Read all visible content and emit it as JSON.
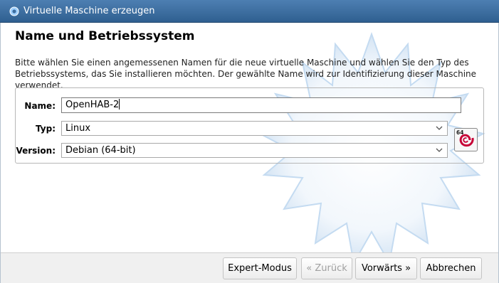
{
  "window": {
    "title": "Virtuelle Maschine erzeugen"
  },
  "page": {
    "heading": "Name und Betriebssystem",
    "description": "Bitte wählen Sie einen angemessenen Namen für die neue virtuelle Maschine und wählen Sie den Typ des Betriebssystems, das Sie installieren möchten. Der gewählte Name wird zur Identifizierung dieser Maschine verwendet."
  },
  "form": {
    "name_label": "Name:",
    "name_value": "OpenHAB-2",
    "type_label": "Typ:",
    "type_value": "Linux",
    "version_label": "Version:",
    "version_value": "Debian (64-bit)",
    "os_icon_badge": "64",
    "os_icon": "debian-swirl-icon"
  },
  "buttons": {
    "expert": "Expert-Modus",
    "back": "« Zurück",
    "next": "Vorwärts »",
    "cancel": "Abbrechen"
  },
  "colors": {
    "titlebar": "#3b6ea1",
    "debian_red": "#c70036",
    "decor_blue": "#d6e6f6"
  }
}
